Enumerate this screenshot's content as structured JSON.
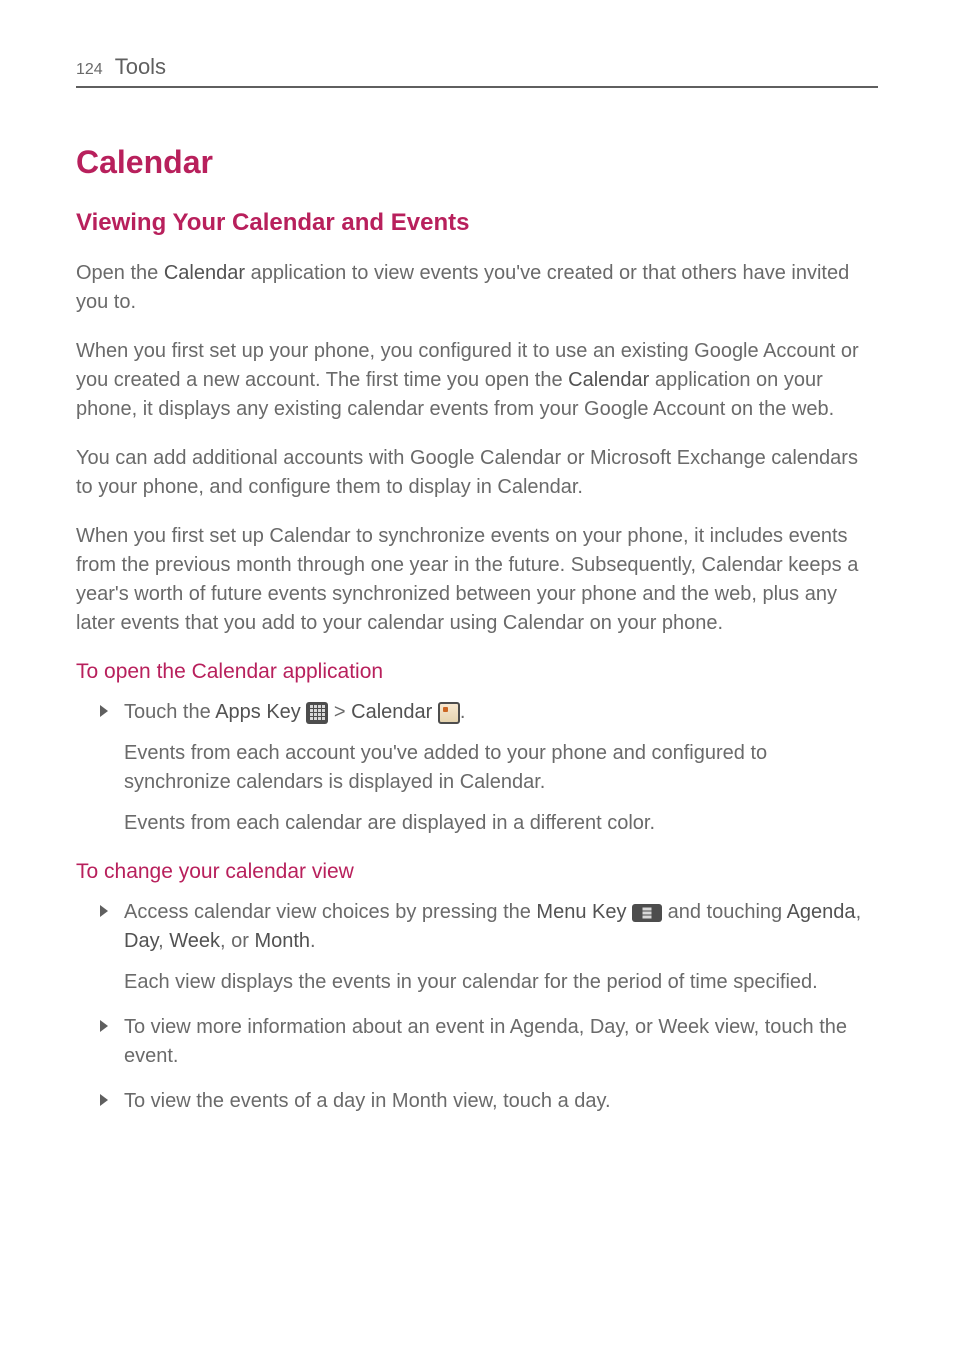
{
  "header": {
    "page_number": "124",
    "section": "Tools"
  },
  "h1": "Calendar",
  "h2": "Viewing Your Calendar and Events",
  "para1": {
    "pre": "Open the ",
    "bold": "Calendar",
    "post": " application to view events you've created or that others have invited you to."
  },
  "para2": {
    "pre": "When you first set up your phone, you configured it to use an existing Google Account or you created a new account. The first time you open the ",
    "bold": "Calendar",
    "post": " application on your phone, it displays any existing calendar events from your Google Account on the web."
  },
  "para3": "You can add additional accounts with Google Calendar or Microsoft Exchange calendars to your phone, and configure them to display in Calendar.",
  "para4": "When you first set up Calendar to synchronize events on your phone, it includes events from the previous month through one year in the future. Subsequently, Calendar keeps a year's worth of future events synchronized between your phone and the web, plus any later events that you add to your calendar using Calendar on your phone.",
  "h3a": "To open the Calendar application",
  "li1": {
    "pre": "Touch the ",
    "apps": "Apps Key ",
    "gt": " > ",
    "cal": "Calendar ",
    "dot": "."
  },
  "sub1": "Events from each account you've added to your phone and configured to synchronize calendars is displayed in Calendar.",
  "sub2": "Events from each calendar are displayed in a different color.",
  "h3b": "To change your calendar view",
  "li2": {
    "pre": "Access calendar view choices by pressing the ",
    "menu": "Menu Key ",
    "and": " and touching ",
    "agenda": "Agenda",
    "c1": ", ",
    "day": "Day",
    "c2": ", ",
    "week": "Week",
    "c3": ", or ",
    "month": "Month",
    "dot": "."
  },
  "sub3": "Each view displays the events in your calendar for the period of time specified.",
  "li3": "To view more information about an event in Agenda, Day, or Week view, touch the event.",
  "li4": "To view the events of a day in Month view, touch a day."
}
